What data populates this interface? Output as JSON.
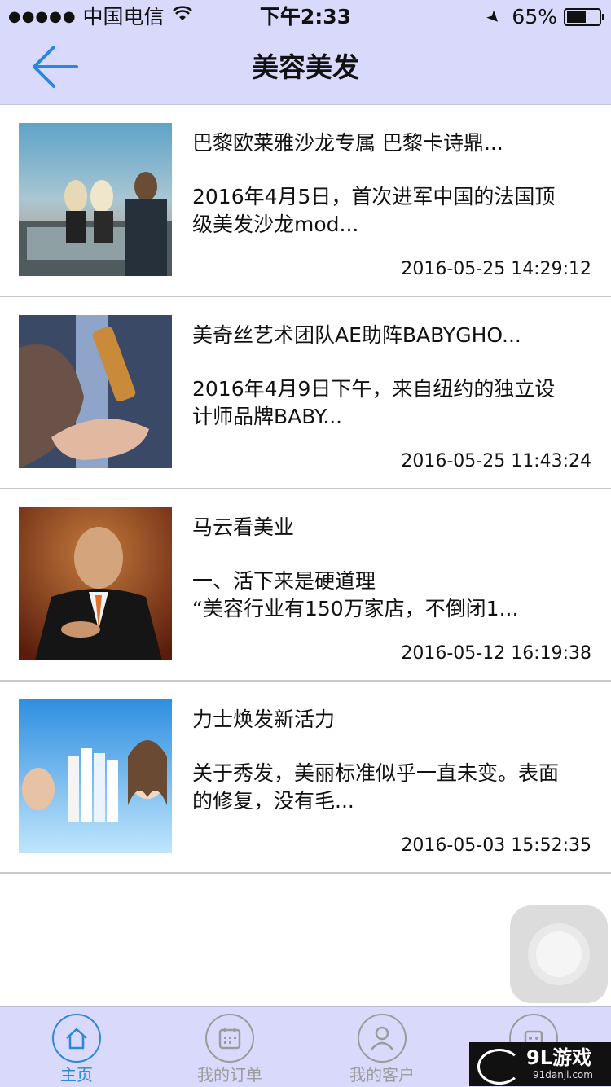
{
  "status_bar": {
    "carrier": "中国电信",
    "time": "下午2:33",
    "battery": "65%",
    "battery_level": 0.65
  },
  "nav": {
    "title": "美容美发",
    "back_icon": "back-arrow-icon",
    "accent": "#2b87d8"
  },
  "articles": [
    {
      "title": "巴黎欧莱雅沙龙专属 巴黎卡诗鼎...",
      "summary": "2016年4月5日，首次进军中国的法国顶级美发沙龙mod...",
      "date": "2016-05-25 14:29:12"
    },
    {
      "title": "美奇丝艺术团队AE助阵BABYGHO...",
      "summary": "2016年4月9日下午，来自纽约的独立设计师品牌BABY...",
      "date": "2016-05-25 11:43:24"
    },
    {
      "title": "马云看美业",
      "summary": "一、活下来是硬道理\n“美容行业有150万家店，不倒闭1...",
      "date": "2016-05-12 16:19:38"
    },
    {
      "title": "力士焕发新活力",
      "summary": "关于秀发，美丽标准似乎一直未变。表面的修复，没有毛...",
      "date": "2016-05-03 15:52:35"
    }
  ],
  "tabs": [
    {
      "label": "主页",
      "icon": "home-icon",
      "active": true
    },
    {
      "label": "我的订单",
      "icon": "calendar-icon",
      "active": false
    },
    {
      "label": "我的客户",
      "icon": "person-icon",
      "active": false
    },
    {
      "label": "",
      "icon": "robot-icon",
      "active": false
    }
  ],
  "watermark": {
    "logo": "9L游戏",
    "url": "91danji.com"
  },
  "colors": {
    "bar_background": "#d9d9fb",
    "active_tab": "#2b87d8",
    "inactive_tab": "#9b9b9b"
  }
}
